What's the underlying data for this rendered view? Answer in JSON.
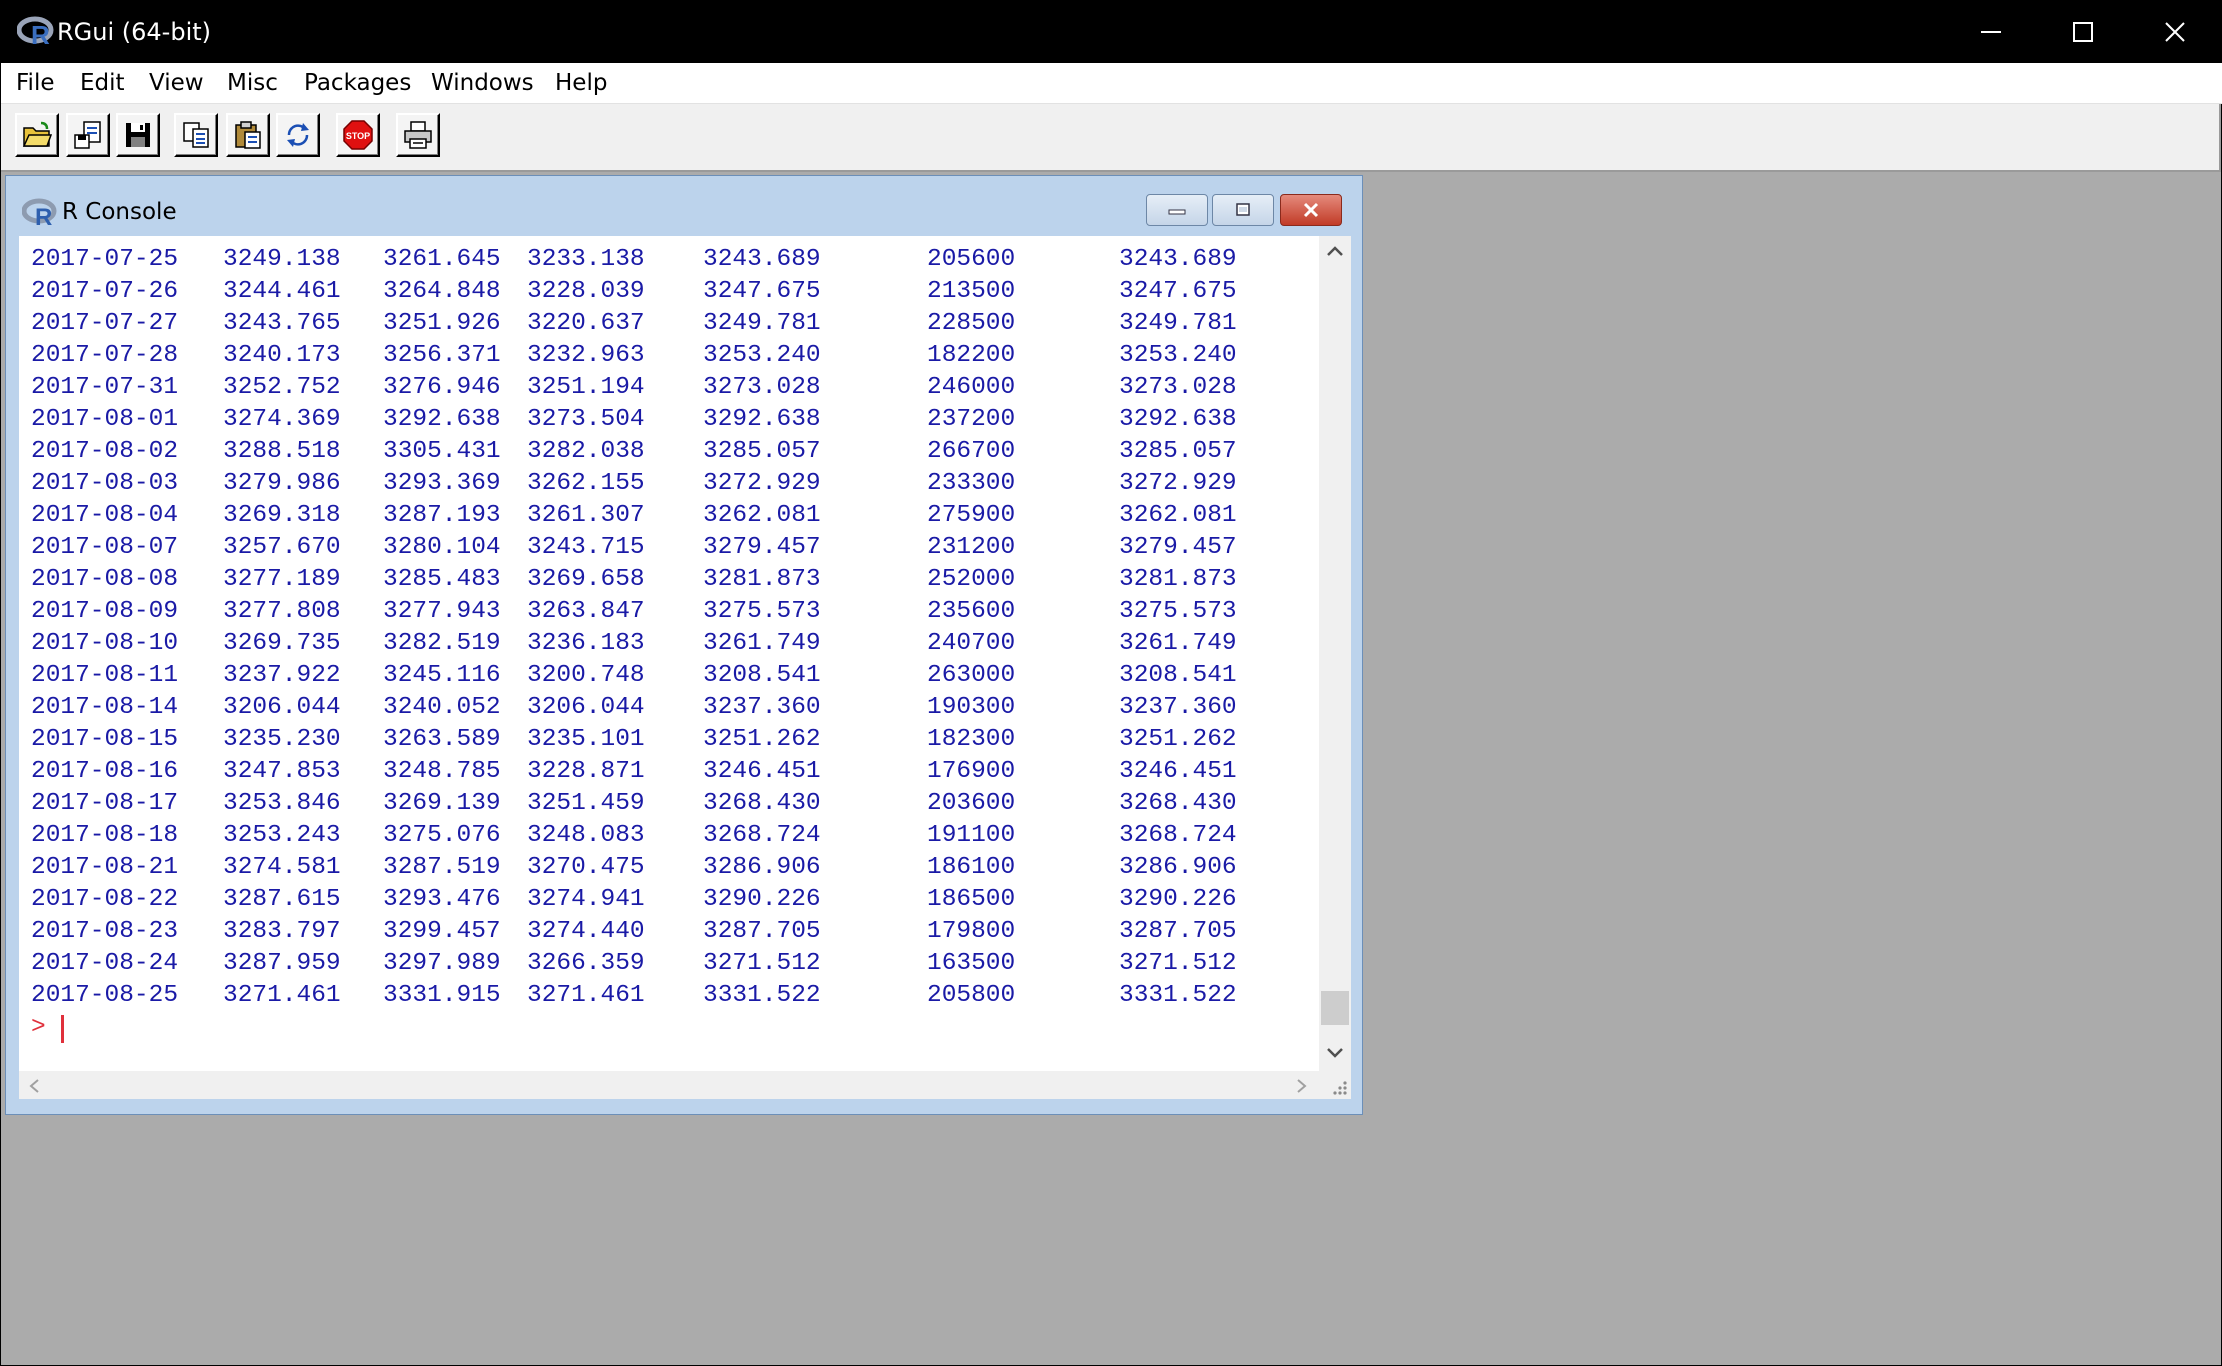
{
  "window": {
    "title": "RGui (64-bit)"
  },
  "menu": [
    "File",
    "Edit",
    "View",
    "Misc",
    "Packages",
    "Windows",
    "Help"
  ],
  "toolbar": {
    "buttons": [
      "open-script-icon",
      "load-workspace-icon",
      "save-workspace-icon",
      "copy-icon",
      "paste-icon",
      "refresh-icon",
      "stop-icon",
      "print-icon"
    ]
  },
  "console": {
    "title": "R Console",
    "prompt": ">",
    "rows": [
      [
        "2017-07-25",
        "3249.138",
        "3261.645",
        "3233.138",
        "3243.689",
        "205600",
        "3243.689"
      ],
      [
        "2017-07-26",
        "3244.461",
        "3264.848",
        "3228.039",
        "3247.675",
        "213500",
        "3247.675"
      ],
      [
        "2017-07-27",
        "3243.765",
        "3251.926",
        "3220.637",
        "3249.781",
        "228500",
        "3249.781"
      ],
      [
        "2017-07-28",
        "3240.173",
        "3256.371",
        "3232.963",
        "3253.240",
        "182200",
        "3253.240"
      ],
      [
        "2017-07-31",
        "3252.752",
        "3276.946",
        "3251.194",
        "3273.028",
        "246000",
        "3273.028"
      ],
      [
        "2017-08-01",
        "3274.369",
        "3292.638",
        "3273.504",
        "3292.638",
        "237200",
        "3292.638"
      ],
      [
        "2017-08-02",
        "3288.518",
        "3305.431",
        "3282.038",
        "3285.057",
        "266700",
        "3285.057"
      ],
      [
        "2017-08-03",
        "3279.986",
        "3293.369",
        "3262.155",
        "3272.929",
        "233300",
        "3272.929"
      ],
      [
        "2017-08-04",
        "3269.318",
        "3287.193",
        "3261.307",
        "3262.081",
        "275900",
        "3262.081"
      ],
      [
        "2017-08-07",
        "3257.670",
        "3280.104",
        "3243.715",
        "3279.457",
        "231200",
        "3279.457"
      ],
      [
        "2017-08-08",
        "3277.189",
        "3285.483",
        "3269.658",
        "3281.873",
        "252000",
        "3281.873"
      ],
      [
        "2017-08-09",
        "3277.808",
        "3277.943",
        "3263.847",
        "3275.573",
        "235600",
        "3275.573"
      ],
      [
        "2017-08-10",
        "3269.735",
        "3282.519",
        "3236.183",
        "3261.749",
        "240700",
        "3261.749"
      ],
      [
        "2017-08-11",
        "3237.922",
        "3245.116",
        "3200.748",
        "3208.541",
        "263000",
        "3208.541"
      ],
      [
        "2017-08-14",
        "3206.044",
        "3240.052",
        "3206.044",
        "3237.360",
        "190300",
        "3237.360"
      ],
      [
        "2017-08-15",
        "3235.230",
        "3263.589",
        "3235.101",
        "3251.262",
        "182300",
        "3251.262"
      ],
      [
        "2017-08-16",
        "3247.853",
        "3248.785",
        "3228.871",
        "3246.451",
        "176900",
        "3246.451"
      ],
      [
        "2017-08-17",
        "3253.846",
        "3269.139",
        "3251.459",
        "3268.430",
        "203600",
        "3268.430"
      ],
      [
        "2017-08-18",
        "3253.243",
        "3275.076",
        "3248.083",
        "3268.724",
        "191100",
        "3268.724"
      ],
      [
        "2017-08-21",
        "3274.581",
        "3287.519",
        "3270.475",
        "3286.906",
        "186100",
        "3286.906"
      ],
      [
        "2017-08-22",
        "3287.615",
        "3293.476",
        "3274.941",
        "3290.226",
        "186500",
        "3290.226"
      ],
      [
        "2017-08-23",
        "3283.797",
        "3299.457",
        "3274.440",
        "3287.705",
        "179800",
        "3287.705"
      ],
      [
        "2017-08-24",
        "3287.959",
        "3297.989",
        "3266.359",
        "3271.512",
        "163500",
        "3271.512"
      ],
      [
        "2017-08-25",
        "3271.461",
        "3331.915",
        "3271.461",
        "3331.522",
        "205800",
        "3331.522"
      ]
    ]
  },
  "colors": {
    "output_text": "#1a1aa6",
    "prompt": "#e0303b",
    "mdi_background": "#ababab"
  }
}
